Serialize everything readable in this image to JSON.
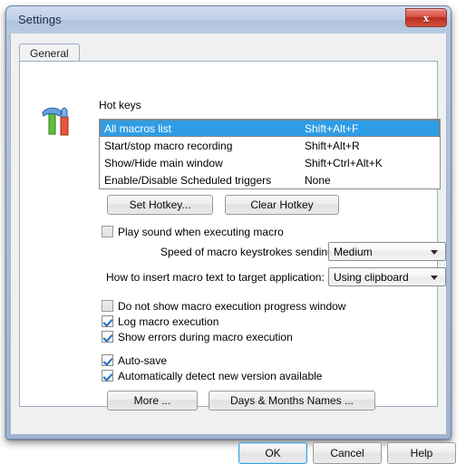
{
  "window": {
    "title": "Settings",
    "close_label": "x",
    "close_icon": "close-icon"
  },
  "tabs": [
    {
      "label": "General",
      "selected": true
    }
  ],
  "icon": {
    "name": "tools-hammer-screwdriver-icon"
  },
  "hotkeys": {
    "group_label": "Hot keys",
    "rows": [
      {
        "name": "All macros list",
        "key": "Shift+Alt+F",
        "selected": true
      },
      {
        "name": "Start/stop macro recording",
        "key": "Shift+Alt+R",
        "selected": false
      },
      {
        "name": "Show/Hide main window",
        "key": "Shift+Ctrl+Alt+K",
        "selected": false
      },
      {
        "name": "Enable/Disable Scheduled triggers",
        "key": "None",
        "selected": false
      }
    ],
    "set_button": "Set Hotkey...",
    "clear_button": "Clear Hotkey"
  },
  "options": {
    "play_sound": {
      "label": "Play sound when executing macro",
      "checked": false
    },
    "speed": {
      "label": "Speed of macro keystrokes sending:",
      "value": "Medium"
    },
    "insert_method": {
      "label": "How to insert macro text to target application:",
      "value": "Using clipboard"
    },
    "no_progress_window": {
      "label": "Do not show macro execution progress window",
      "checked": false
    },
    "log_execution": {
      "label": "Log macro execution",
      "checked": true
    },
    "show_errors": {
      "label": "Show errors during macro execution",
      "checked": true
    },
    "auto_save": {
      "label": "Auto-save",
      "checked": true
    },
    "auto_detect_version": {
      "label": "Automatically detect new version available",
      "checked": true
    }
  },
  "extra_buttons": {
    "more": "More ...",
    "days_months": "Days & Months Names ..."
  },
  "footer": {
    "ok": "OK",
    "cancel": "Cancel",
    "help": "Help"
  },
  "colors": {
    "selection": "#2f9de6",
    "close_button": "#bb2d20",
    "title_bar": "#bfd0e6",
    "checkmark": "#1f6fc4",
    "focus_ring": "#3ea0dd"
  }
}
